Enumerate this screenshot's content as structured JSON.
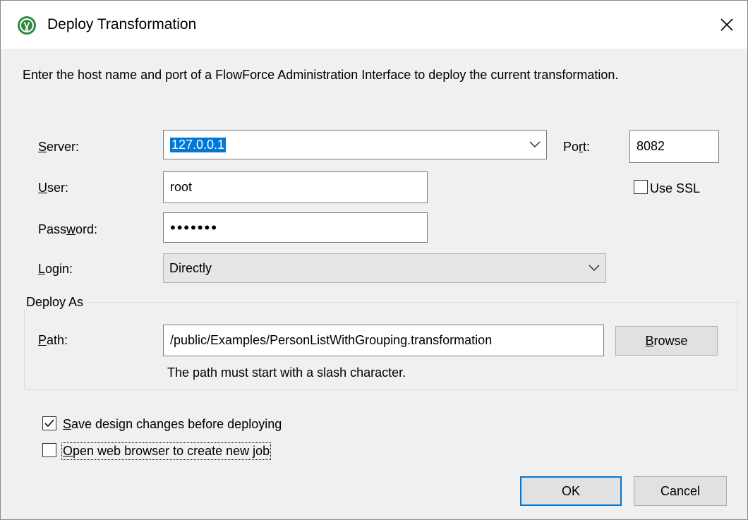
{
  "window": {
    "title": "Deploy Transformation",
    "icon": "altova-mapforce-icon",
    "close_icon": "close-icon"
  },
  "intro_text": "Enter the host name and port of a FlowForce Administration Interface to deploy the current transformation.",
  "server": {
    "label_u": "S",
    "label_rest": "erver:",
    "value": "127.0.0.1"
  },
  "port": {
    "label_pre": "Po",
    "label_u": "r",
    "label_rest": "t:",
    "value": "8082"
  },
  "user": {
    "label_u": "U",
    "label_rest": "ser:",
    "value": "root"
  },
  "use_ssl": {
    "label": "Use SSL",
    "checked": false
  },
  "password": {
    "label_pre": "Pass",
    "label_u": "w",
    "label_rest": "ord:",
    "value": "•••••••"
  },
  "login": {
    "label_u": "L",
    "label_rest": "ogin:",
    "value": "Directly"
  },
  "deploy_as": {
    "legend": "Deploy As",
    "path_label_u": "P",
    "path_label_rest": "ath:",
    "path_value": "/public/Examples/PersonListWithGrouping.transformation",
    "browse_u": "B",
    "browse_rest": "rowse",
    "hint": "The path must start with a slash character."
  },
  "save_changes": {
    "label_u": "S",
    "label_rest": "ave design changes before deploying",
    "checked": true
  },
  "open_browser": {
    "label_u": "O",
    "label_rest": "pen web browser to create new job",
    "checked": false
  },
  "buttons": {
    "ok": "OK",
    "cancel": "Cancel"
  }
}
